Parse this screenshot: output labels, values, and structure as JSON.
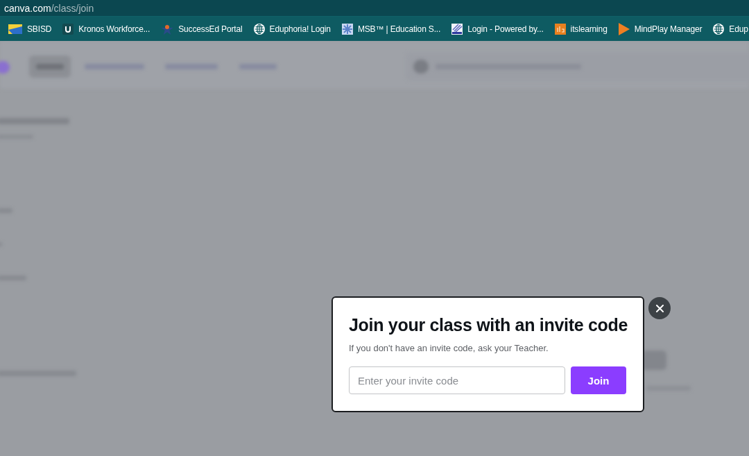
{
  "address_bar": {
    "host": "canva.com",
    "path": "/class/join"
  },
  "bookmarks": [
    {
      "label": "SBISD"
    },
    {
      "label": "Kronos Workforce..."
    },
    {
      "label": "SuccessEd Portal"
    },
    {
      "label": "Eduphoria! Login"
    },
    {
      "label": "MSB™ | Education S..."
    },
    {
      "label": "Login - Powered by..."
    },
    {
      "label": "itslearning"
    },
    {
      "label": "MindPlay Manager"
    },
    {
      "label": "Edup"
    }
  ],
  "dialog": {
    "title": "Join your class with an invite code",
    "subtitle": "If you don't have an invite code, ask your Teacher.",
    "invite_field": {
      "placeholder": "Enter your invite code"
    },
    "join_button": "Join"
  }
}
